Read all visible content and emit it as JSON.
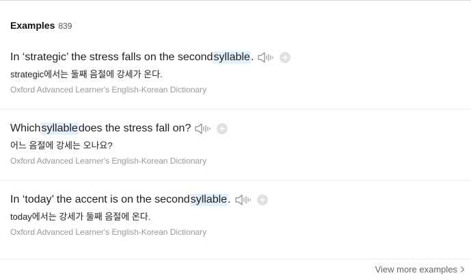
{
  "header": {
    "title": "Examples",
    "count": "839"
  },
  "examples": [
    {
      "before": "In ‘strategic’ the stress falls on the second ",
      "highlight": "syllable",
      "after": ".",
      "translation": "strategic에서는 둘째 음절에 강세가 온다.",
      "source": "Oxford Advanced Learner's English-Korean Dictionary"
    },
    {
      "before": "Which ",
      "highlight": "syllable",
      "after": " does the stress fall on?",
      "translation": "어느 음절에 강세는 오나요?",
      "source": "Oxford Advanced Learner's English-Korean Dictionary"
    },
    {
      "before": "In ‘today’ the accent is on the second ",
      "highlight": "syllable",
      "after": ".",
      "translation": "today에서는 강세가 둘째 음절에 온다.",
      "source": "Oxford Advanced Learner's English-Korean Dictionary"
    }
  ],
  "footer": {
    "more_label": "View more examples"
  },
  "icons": {
    "audio": "speaker-icon",
    "add": "plus-icon",
    "more": "chevron-right-icon"
  },
  "colors": {
    "highlight": "#e3f0fb",
    "source_text": "#999999",
    "icon_gray": "#9a9a9a"
  }
}
